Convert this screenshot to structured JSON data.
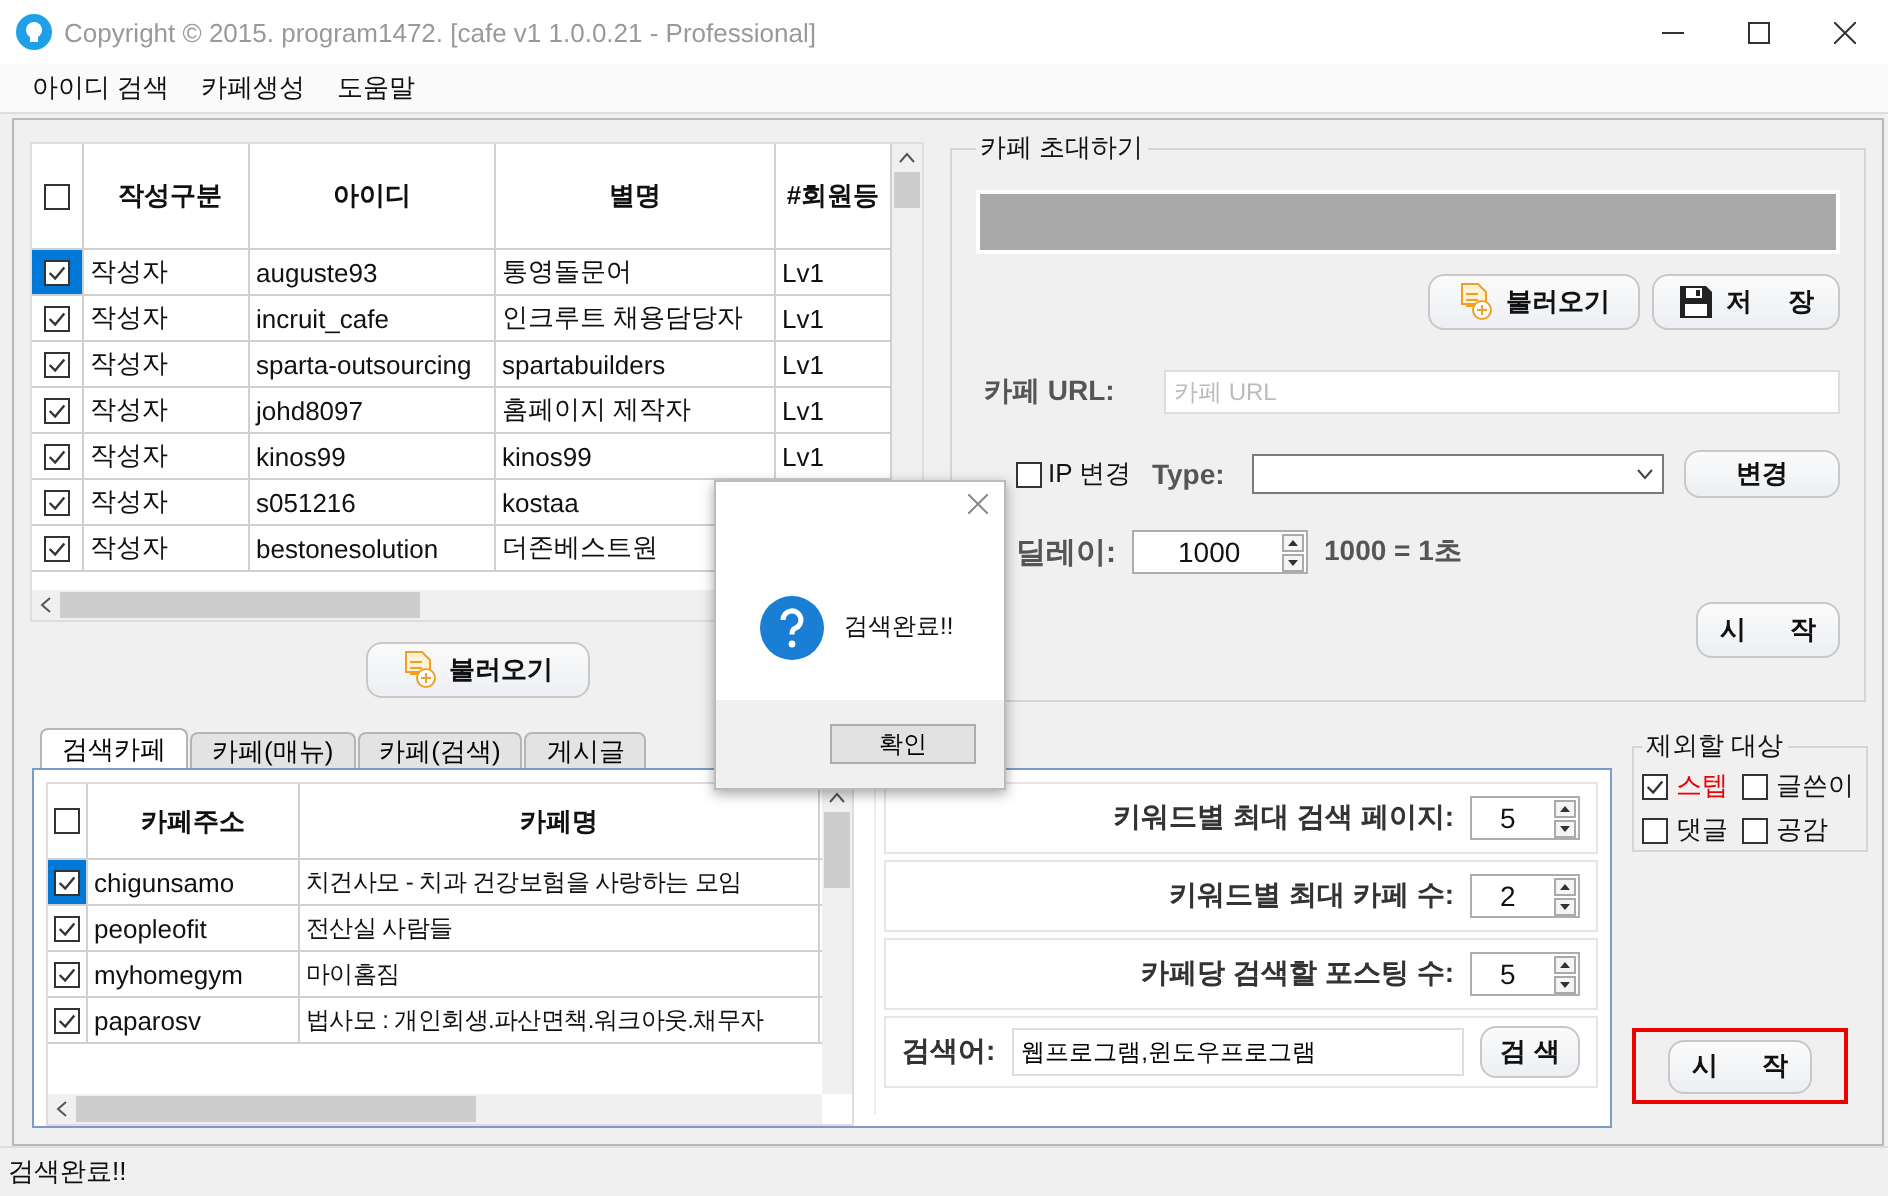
{
  "window": {
    "title": "Copyright © 2015. program1472. [cafe v1 1.0.0.21 - Professional]"
  },
  "menu": [
    "아이디 검색",
    "카페생성",
    "도움말"
  ],
  "writer_grid": {
    "columns": [
      "작성구분",
      "아이디",
      "별명",
      "#회원등"
    ],
    "all_checked": false,
    "rows": [
      {
        "type": "작성자",
        "id": "auguste93",
        "nickname": "통영돌문어",
        "level": "Lv1",
        "checked": true,
        "selected": true
      },
      {
        "type": "작성자",
        "id": "incruit_cafe",
        "nickname": "인크루트 채용담당자",
        "level": "Lv1",
        "checked": true,
        "selected": false
      },
      {
        "type": "작성자",
        "id": "sparta-outsourcing",
        "nickname": "spartabuilders",
        "level": "Lv1",
        "checked": true,
        "selected": false
      },
      {
        "type": "작성자",
        "id": "johd8097",
        "nickname": "홈페이지 제작자",
        "level": "Lv1",
        "checked": true,
        "selected": false
      },
      {
        "type": "작성자",
        "id": "kinos99",
        "nickname": "kinos99",
        "level": "Lv1",
        "checked": true,
        "selected": false
      },
      {
        "type": "작성자",
        "id": "s051216",
        "nickname": "kostaa",
        "checked": true,
        "selected": false
      },
      {
        "type": "작성자",
        "id": "bestonesolution",
        "nickname": "더존베스트원",
        "checked": true,
        "selected": false
      }
    ]
  },
  "load_button": "불러오기",
  "invite": {
    "title": "카페 초대하기",
    "load_button": "불러오기",
    "save_button": "저 장",
    "url_label": "카페 URL:",
    "url_placeholder": "카페 URL",
    "ip_change": {
      "label": "IP 변경",
      "checked": false
    },
    "type_label": "Type:",
    "change_button": "변경",
    "delay_label": "딜레이:",
    "delay_value": "1000",
    "delay_note": "1000 = 1초",
    "start_button": "시 작"
  },
  "tabs": [
    {
      "label": "검색카페",
      "selected": true
    },
    {
      "label": "카페(매뉴)",
      "selected": false
    },
    {
      "label": "카페(검색)",
      "selected": false
    },
    {
      "label": "게시글",
      "selected": false
    }
  ],
  "cafe_grid": {
    "columns": [
      "카페주소",
      "카페명"
    ],
    "all_checked": false,
    "rows": [
      {
        "address": "chigunsamo",
        "name": "치건사모 - 치과 건강보험을 사랑하는 모임",
        "checked": true,
        "selected": true
      },
      {
        "address": "peopleofit",
        "name": "전산실 사람들",
        "checked": true,
        "selected": false
      },
      {
        "address": "myhomegym",
        "name": "마이홈짐",
        "checked": true,
        "selected": false
      },
      {
        "address": "paparosv",
        "name": "법사모 : 개인회생.파산면책.워크아웃.채무자",
        "checked": true,
        "selected": false
      }
    ]
  },
  "search_settings": {
    "fields": [
      {
        "label": "키워드별 최대 검색 페이지:",
        "value": "5"
      },
      {
        "label": "키워드별 최대 카페 수:",
        "value": "2"
      },
      {
        "label": "카페당 검색할 포스팅 수:",
        "value": "5"
      }
    ],
    "keyword_label": "검색어:",
    "keyword_value": "웹프로그램,윈도우프로그램",
    "search_button": "검 색"
  },
  "exclude": {
    "title": "제외할 대상",
    "options": [
      {
        "label": "스텝",
        "checked": true
      },
      {
        "label": "글쓴이",
        "checked": false
      },
      {
        "label": "댓글",
        "checked": false
      },
      {
        "label": "공감",
        "checked": false
      }
    ]
  },
  "start_button": {
    "label": "시 작",
    "highlighted": true
  },
  "dialog": {
    "message": "검색완료!!",
    "ok_button": "확인"
  },
  "status_bar": "검색완료!!"
}
